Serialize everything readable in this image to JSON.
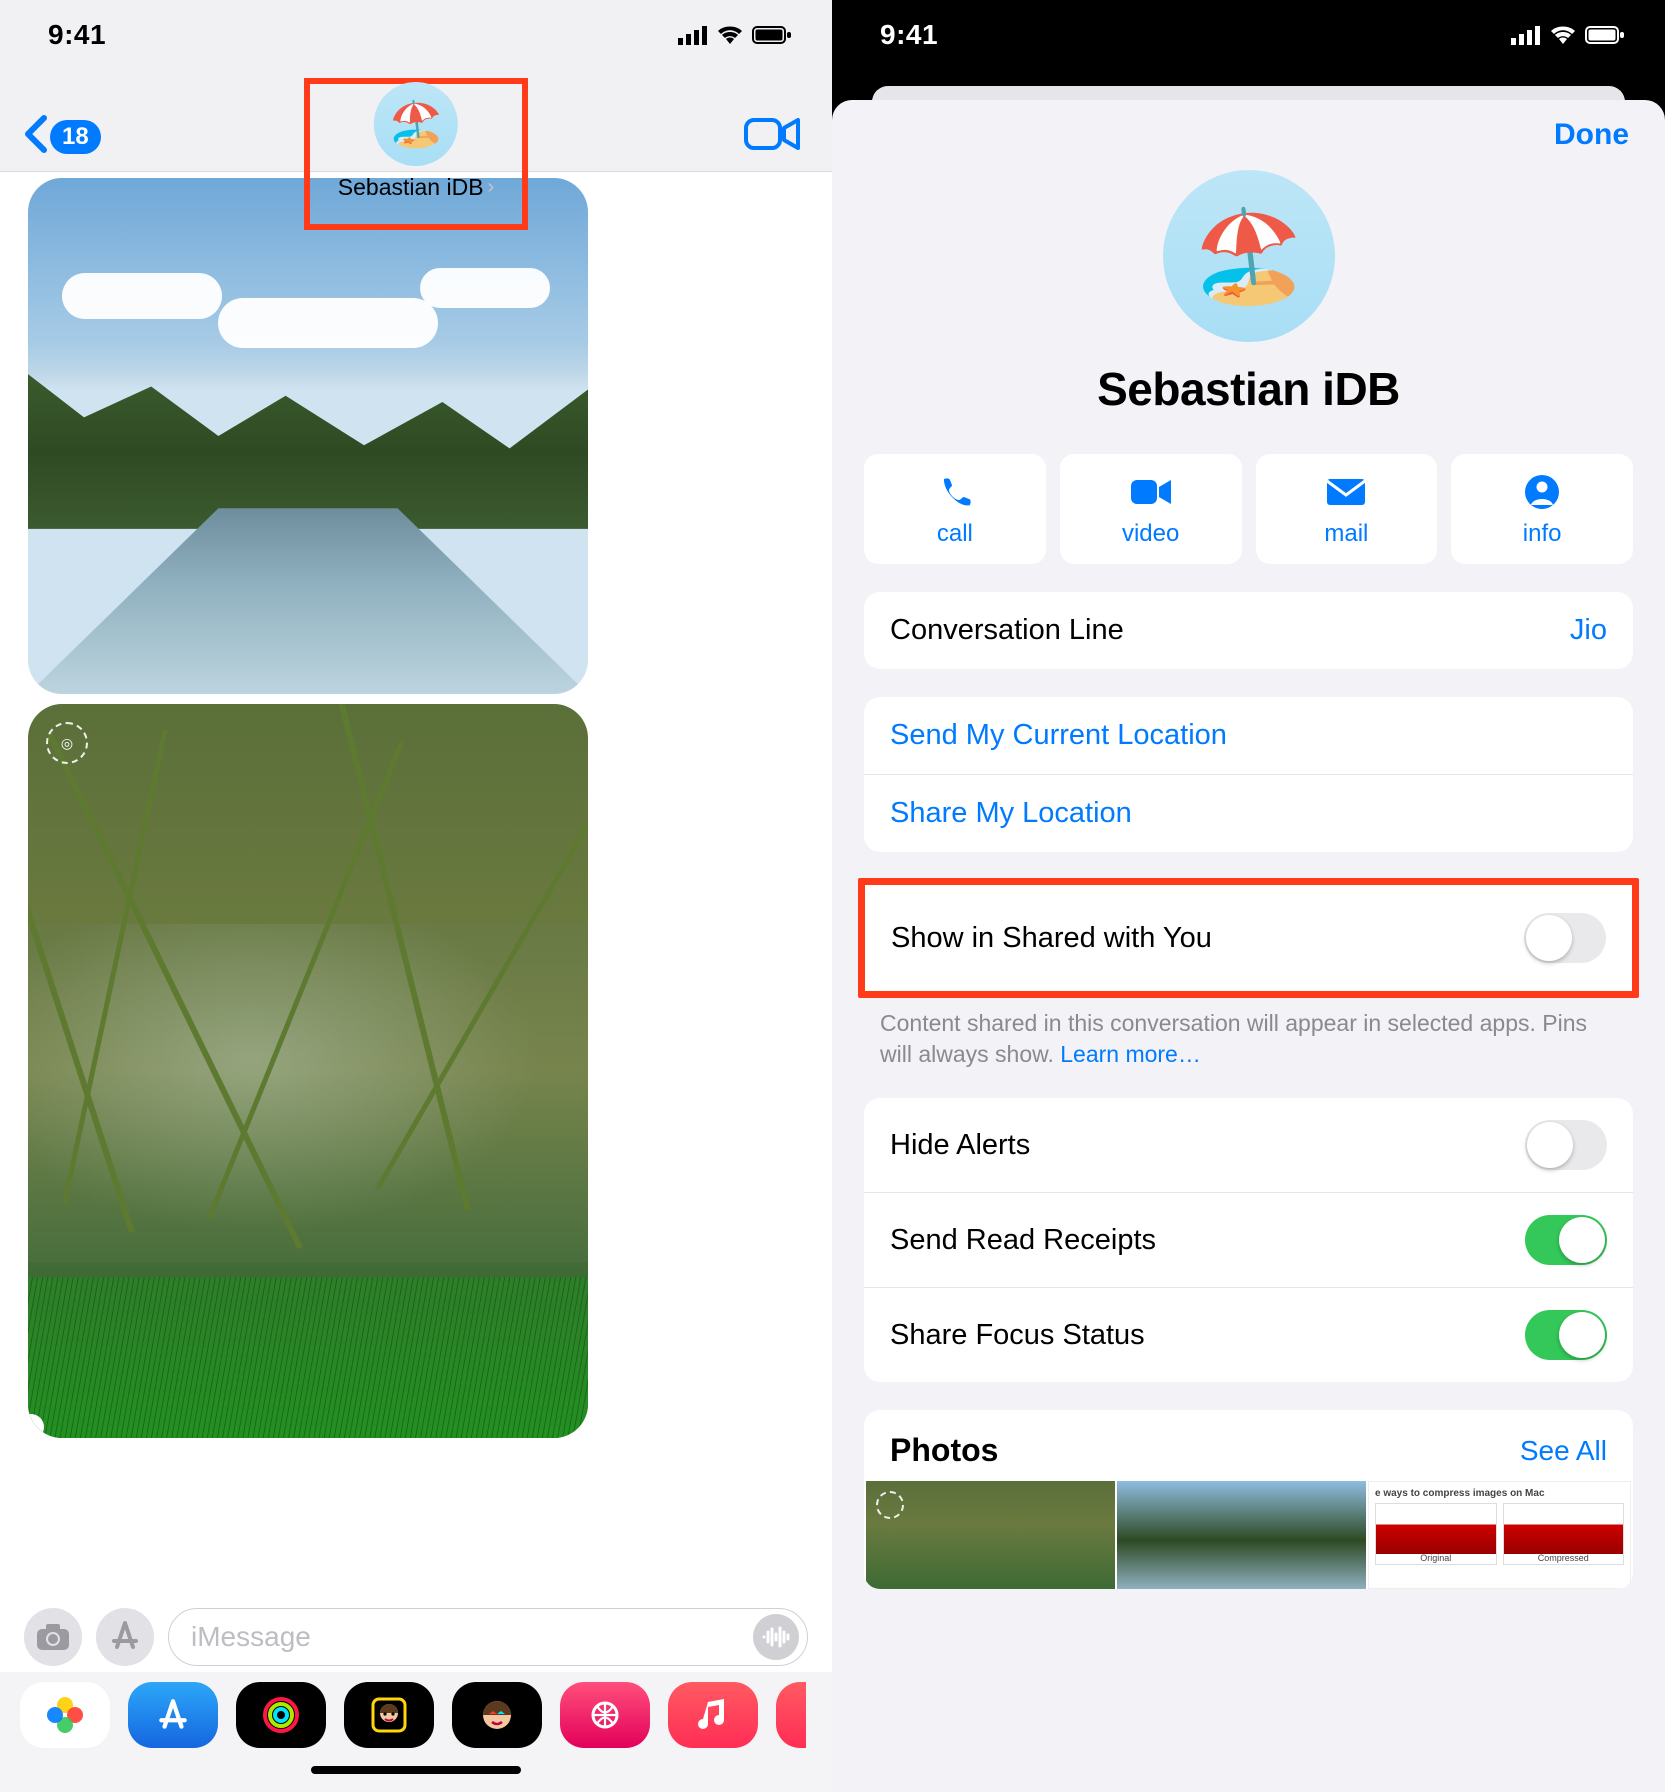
{
  "status": {
    "time": "9:41"
  },
  "left": {
    "back_badge": "18",
    "contact_name": "Sebastian iDB",
    "compose_placeholder": "iMessage"
  },
  "right": {
    "done": "Done",
    "contact_name": "Sebastian iDB",
    "actions": {
      "call": "call",
      "video": "video",
      "mail": "mail",
      "info": "info"
    },
    "conversation_line": {
      "label": "Conversation Line",
      "value": "Jio"
    },
    "send_current_location": "Send My Current Location",
    "share_my_location": "Share My Location",
    "show_in_shared": "Show in Shared with You",
    "shared_note_a": "Content shared in this conversation will appear in selected apps. Pins will always show. ",
    "shared_note_link": "Learn more…",
    "hide_alerts": "Hide Alerts",
    "send_read_receipts": "Send Read Receipts",
    "share_focus_status": "Share Focus Status",
    "photos_title": "Photos",
    "see_all": "See All",
    "thumb3_hdr": "e ways to compress images on Mac",
    "thumb3_a": "Original",
    "thumb3_b": "Compressed"
  },
  "toggles": {
    "show_in_shared": false,
    "hide_alerts": false,
    "send_read_receipts": true,
    "share_focus_status": true
  }
}
